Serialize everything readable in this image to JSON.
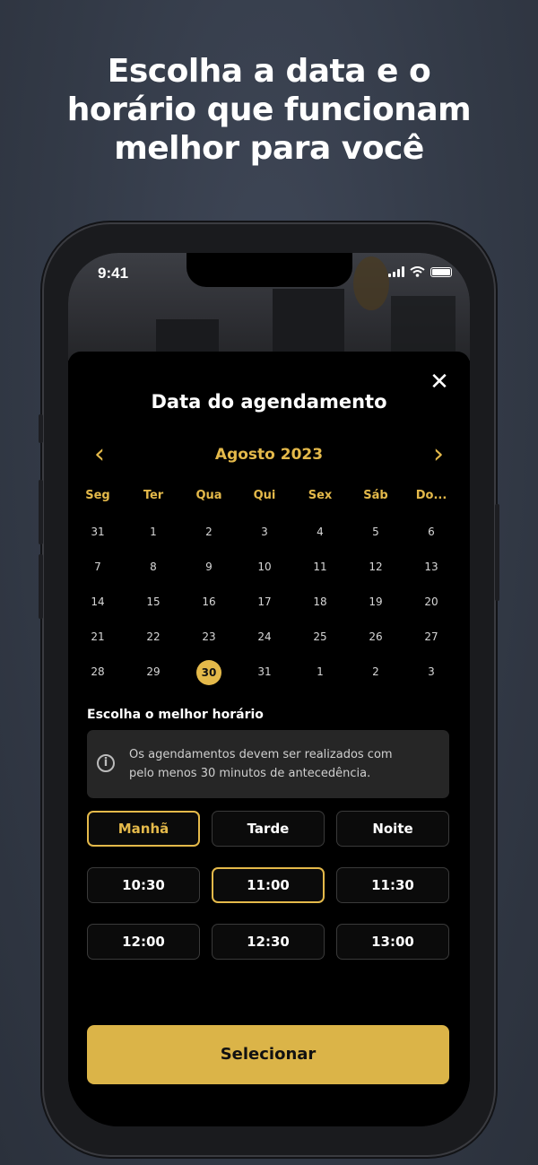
{
  "headline": {
    "line1": "Escolha a data e o",
    "line2": "horário que funcionam",
    "line3": "melhor para você"
  },
  "status_bar": {
    "time": "9:41"
  },
  "sheet": {
    "title": "Data do agendamento",
    "close_icon": "close-icon"
  },
  "calendar": {
    "month_label": "Agosto 2023",
    "prev_icon": "chevron-left-icon",
    "next_icon": "chevron-right-icon",
    "weekdays": [
      "Seg",
      "Ter",
      "Qua",
      "Qui",
      "Sex",
      "Sáb",
      "Do..."
    ],
    "weeks": [
      [
        "31",
        "1",
        "2",
        "3",
        "4",
        "5",
        "6"
      ],
      [
        "7",
        "8",
        "9",
        "10",
        "11",
        "12",
        "13"
      ],
      [
        "14",
        "15",
        "16",
        "17",
        "18",
        "19",
        "20"
      ],
      [
        "21",
        "22",
        "23",
        "24",
        "25",
        "26",
        "27"
      ],
      [
        "28",
        "29",
        "30",
        "31",
        "1",
        "2",
        "3"
      ]
    ],
    "selected_day": "30"
  },
  "time_section": {
    "title": "Escolha o melhor horário",
    "info_icon": "info-icon",
    "info_line1": "Os agendamentos devem ser realizados com",
    "info_line2": "pelo menos 30 minutos de antecedência.",
    "periods": [
      "Manhã",
      "Tarde",
      "Noite"
    ],
    "active_period": "Manhã",
    "slots_row1": [
      "10:30",
      "11:00",
      "11:30"
    ],
    "slots_row2": [
      "12:00",
      "12:30",
      "13:00"
    ],
    "active_slot": "11:00"
  },
  "actions": {
    "select_label": "Selecionar"
  },
  "colors": {
    "accent": "#e4b94a",
    "button": "#dbb448",
    "sheet": "#000000",
    "info_bg": "#262626"
  }
}
